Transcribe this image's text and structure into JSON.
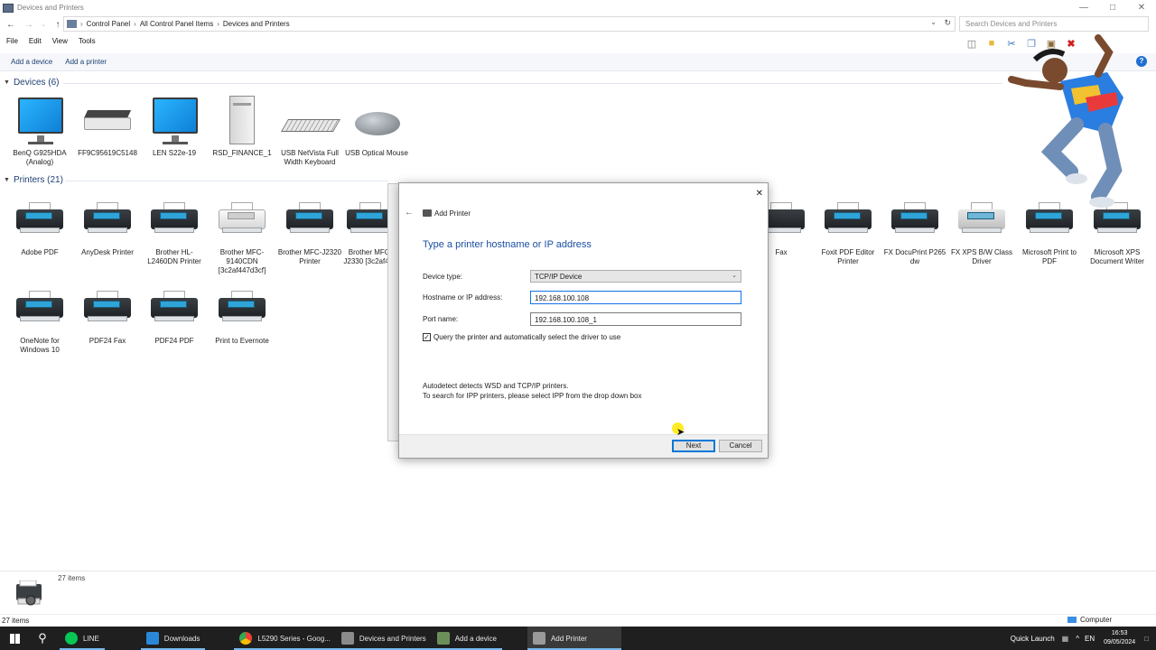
{
  "window": {
    "title": "Devices and Printers"
  },
  "address": {
    "crumbs": [
      "Control Panel",
      "All Control Panel Items",
      "Devices and Printers"
    ],
    "search_placeholder": "Search Devices and Printers"
  },
  "menu": [
    "File",
    "Edit",
    "View",
    "Tools"
  ],
  "commands": {
    "add_device": "Add a device",
    "add_printer": "Add a printer"
  },
  "groups": {
    "devices": {
      "label": "Devices (6)"
    },
    "printers": {
      "label": "Printers (21)"
    }
  },
  "devices": [
    {
      "name": "BenQ G925HDA (Analog)",
      "icon": "monitor-icon"
    },
    {
      "name": "FF9C95619C5148",
      "icon": "scanner-icon"
    },
    {
      "name": "LEN S22e-19",
      "icon": "monitor-icon"
    },
    {
      "name": "RSD_FINANCE_1",
      "icon": "tower-pc-icon"
    },
    {
      "name": "USB NetVista Full Width Keyboard",
      "icon": "keyboard-icon"
    },
    {
      "name": "USB Optical Mouse",
      "icon": "mouse-icon"
    }
  ],
  "printers": [
    {
      "name": "Adobe PDF",
      "icon": "printer-icon"
    },
    {
      "name": "AnyDesk Printer",
      "icon": "printer-icon"
    },
    {
      "name": "Brother HL-L2460DN Printer",
      "icon": "printer-icon"
    },
    {
      "name": "Brother MFC-9140CDN [3c2af447d3cf]",
      "icon": "printer-icon"
    },
    {
      "name": "Brother MFC-J2320 Printer",
      "icon": "printer-icon"
    },
    {
      "name": "Brother MFC-J2330 [3c2af4b6",
      "icon": "printer-icon"
    },
    {
      "name": "Fax",
      "icon": "fax-icon"
    },
    {
      "name": "Foxit PDF Editor Printer",
      "icon": "printer-icon"
    },
    {
      "name": "FX DocuPrint P265 dw",
      "icon": "printer-icon"
    },
    {
      "name": "FX XPS B/W Class Driver",
      "icon": "printer-icon"
    },
    {
      "name": "Microsoft Print to PDF",
      "icon": "printer-icon"
    },
    {
      "name": "Microsoft XPS Document Writer",
      "icon": "printer-icon"
    },
    {
      "name": "OneNote for Windows 10",
      "icon": "printer-icon"
    },
    {
      "name": "PDF24 Fax",
      "icon": "printer-icon"
    },
    {
      "name": "PDF24 PDF",
      "icon": "printer-icon"
    },
    {
      "name": "Print to Evernote",
      "icon": "printer-icon"
    }
  ],
  "dialog": {
    "title": "Add Printer",
    "heading": "Type a printer hostname or IP address",
    "device_type_label": "Device type:",
    "device_type_value": "TCP/IP Device",
    "hostname_label": "Hostname or IP address:",
    "hostname_value": "192.168.100.108",
    "port_label": "Port name:",
    "port_value": "192.168.100.108_1",
    "query_checkbox_label": "Query the printer and automatically select the driver to use",
    "query_checked": true,
    "info_line1": "Autodetect detects WSD and TCP/IP printers.",
    "info_line2": "To search for IPP printers, please select IPP from the drop down box",
    "next_label": "Next",
    "cancel_label": "Cancel"
  },
  "details": {
    "count": "27 items"
  },
  "status": {
    "items": "27 items",
    "location": "Computer"
  },
  "taskbar": {
    "items": [
      {
        "label": "LINE",
        "color": "#06c755"
      },
      {
        "label": "Downloads",
        "color": "#2b88d8"
      },
      {
        "label": "L5290 Series - Goog...",
        "color": "#e94235"
      },
      {
        "label": "Devices and Printers",
        "color": "#8a8a8a"
      },
      {
        "label": "Add a device",
        "color": "#6c8f5a"
      },
      {
        "label": "Add Printer",
        "color": "#9a9a9a"
      }
    ],
    "quick_launch": "Quick Launch",
    "lang": "EN",
    "time": "16:53",
    "date": "09/05/2024"
  },
  "colors": {
    "accent": "#1a4ea1",
    "link": "#1e3f72",
    "taskbar": "#1f1f1f"
  }
}
